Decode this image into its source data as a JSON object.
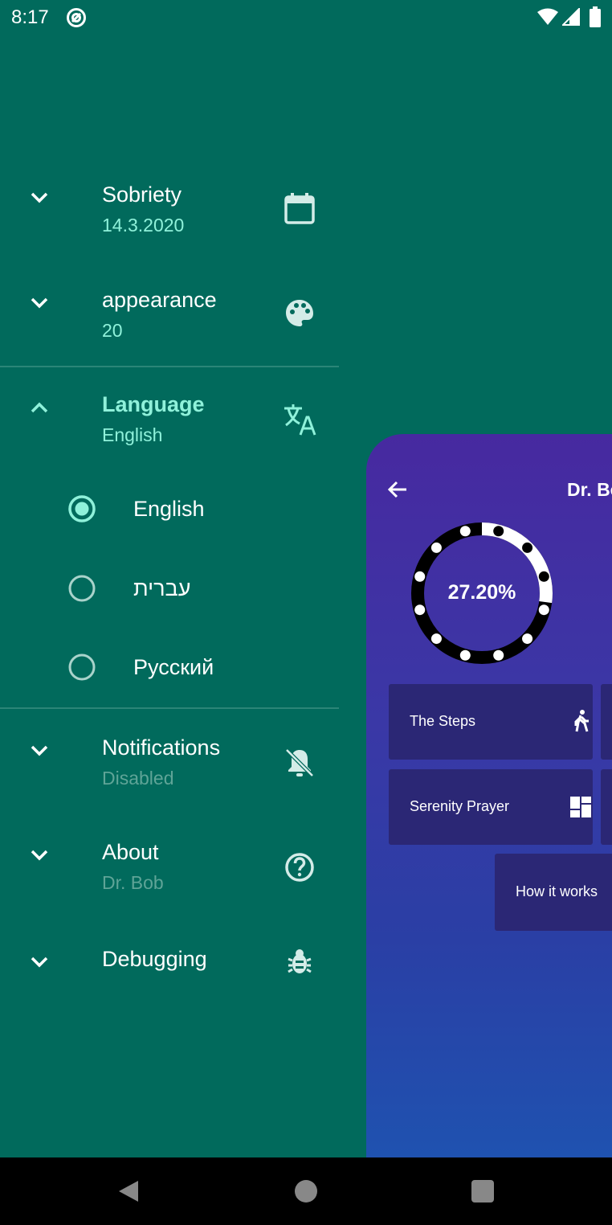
{
  "status_bar": {
    "time": "8:17",
    "icons": [
      "sync-icon",
      "wifi-icon",
      "cell-signal-icon",
      "battery-icon"
    ]
  },
  "menu": {
    "sobriety": {
      "title": "Sobriety",
      "subtitle": "14.3.2020",
      "icon": "calendar-icon",
      "expanded": false
    },
    "appearance": {
      "title": "appearance",
      "subtitle": "20",
      "icon": "palette-icon",
      "expanded": false
    },
    "language": {
      "title": "Language",
      "subtitle": "English",
      "icon": "translate-icon",
      "expanded": true,
      "options": [
        {
          "label": "English",
          "selected": true
        },
        {
          "label": "עברית",
          "selected": false
        },
        {
          "label": "Русский",
          "selected": false
        }
      ]
    },
    "notifications": {
      "title": "Notifications",
      "subtitle": "Disabled",
      "icon": "notifications-off-icon",
      "expanded": false
    },
    "about": {
      "title": "About",
      "subtitle": "Dr. Bob",
      "icon": "help-circle-icon",
      "expanded": false
    },
    "debugging": {
      "title": "Debugging",
      "icon": "bug-icon",
      "expanded": false
    }
  },
  "preview": {
    "title": "Dr. Bo",
    "progress_text": "27.20%",
    "progress_fraction": 0.272,
    "tiles": [
      {
        "label": "The Steps",
        "icon": "walk-icon"
      },
      {
        "label": "Serenity Prayer",
        "icon": "dashboard-icon"
      },
      {
        "label": "How it works"
      }
    ]
  },
  "colors": {
    "background": "#016A5C",
    "accent": "#8FF1DA",
    "dim_text": "#5FA497",
    "card_top": "#4729A0",
    "card_bottom": "#1F52B0",
    "tile": "#2B2775"
  },
  "nav_bar": {
    "icons": [
      "back-triangle-icon",
      "home-circle-icon",
      "recents-square-icon"
    ]
  }
}
